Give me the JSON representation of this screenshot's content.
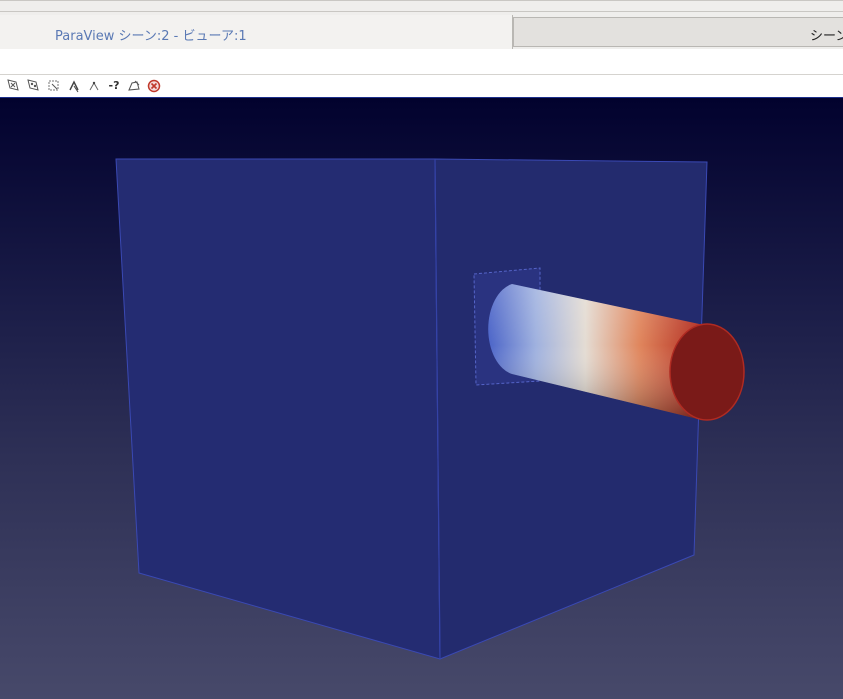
{
  "window": {
    "tabs": [
      {
        "label": "ParaView シーン:2 - ビューア:1",
        "active": true
      },
      {
        "label": "シーン",
        "active": false
      }
    ]
  },
  "toolbar": {
    "icons": [
      "select-cells-on-icon",
      "select-points-on-icon",
      "select-cells-frustum-icon",
      "interactive-select-cells-icon",
      "interactive-select-points-icon",
      "hover-query-icon",
      "select-cells-polygon-icon",
      "clear-selection-icon"
    ],
    "query_label": "-?"
  },
  "viewport": {
    "background_top": "#02022e",
    "background_bottom": "#47496a",
    "box_color": "#252e78",
    "colormap": [
      "#3b4cc0",
      "#dddddd",
      "#b40426"
    ]
  }
}
